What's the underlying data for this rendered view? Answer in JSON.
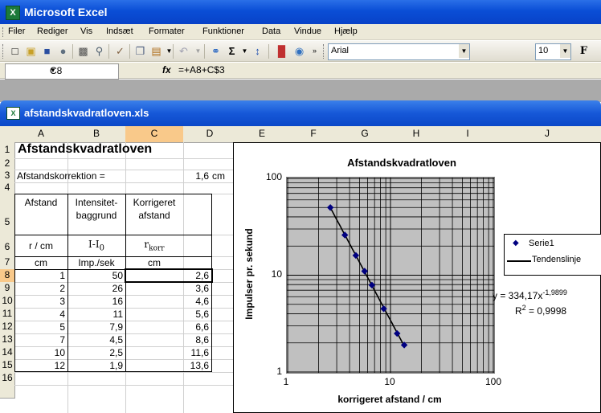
{
  "app": {
    "title": "Microsoft Excel"
  },
  "menu": [
    "Filer",
    "Rediger",
    "Vis",
    "Indsæt",
    "Formater",
    "Funktioner",
    "Data",
    "Vindue",
    "Hjælp"
  ],
  "toolbar": {
    "font": "Arial",
    "size": "10",
    "bold": "F"
  },
  "formula_bar": {
    "cell_ref": "C8",
    "fx": "fx",
    "formula": "=+A8+C$3"
  },
  "workbook": {
    "title": "afstandskvadratloven.xls"
  },
  "grid": {
    "columns": [
      "A",
      "B",
      "C",
      "D",
      "E",
      "F",
      "G",
      "H",
      "I",
      "J"
    ],
    "rows": [
      "1",
      "2",
      "3",
      "4",
      "5",
      "6",
      "7",
      "8",
      "9",
      "10",
      "11",
      "12",
      "13",
      "14",
      "15",
      "16"
    ]
  },
  "sheet": {
    "title": "Afstandskvadratloven",
    "correction_label": "Afstandskorrektion =",
    "correction_value": "1,6",
    "correction_unit": "cm",
    "headers": {
      "a": "Afstand",
      "b1": "Intensitet-",
      "b2": "baggrund",
      "c1": "Korrigeret",
      "c2": "afstand",
      "a_sym": "r / cm",
      "b_sym_main": "I-I",
      "b_sym_sub": "0",
      "c_sym_main": "r",
      "c_sym_sub": "korr",
      "a_unit": "cm",
      "b_unit": "Imp./sek",
      "c_unit": "cm"
    },
    "rows": [
      {
        "a": "1",
        "b": "50",
        "c": "2,6"
      },
      {
        "a": "2",
        "b": "26",
        "c": "3,6"
      },
      {
        "a": "3",
        "b": "16",
        "c": "4,6"
      },
      {
        "a": "4",
        "b": "11",
        "c": "5,6"
      },
      {
        "a": "5",
        "b": "7,9",
        "c": "6,6"
      },
      {
        "a": "7",
        "b": "4,5",
        "c": "8,6"
      },
      {
        "a": "10",
        "b": "2,5",
        "c": "11,6"
      },
      {
        "a": "12",
        "b": "1,9",
        "c": "13,6"
      }
    ]
  },
  "chart_data": {
    "type": "scatter",
    "title": "Afstandskvadratloven",
    "xlabel": "korrigeret afstand / cm",
    "ylabel": "Impulser pr. sekund",
    "x_scale": "log",
    "y_scale": "log",
    "xlim": [
      1,
      100
    ],
    "ylim": [
      1,
      100
    ],
    "x_ticks": [
      "1",
      "10",
      "100"
    ],
    "y_ticks": [
      "1",
      "10",
      "100"
    ],
    "grid": true,
    "legend_position": "right",
    "series": [
      {
        "name": "Serie1",
        "marker": "diamond",
        "color": "#000080",
        "x": [
          2.6,
          3.6,
          4.6,
          5.6,
          6.6,
          8.6,
          11.6,
          13.6
        ],
        "y": [
          50,
          26,
          16,
          11,
          7.9,
          4.5,
          2.5,
          1.9
        ]
      }
    ],
    "trendline": {
      "name": "Tendenslinje",
      "type": "power",
      "coefficient": 334.17,
      "exponent": -1.9899,
      "equation_main": "y = 334,17x",
      "equation_exp": "-1,9899",
      "r2_main": "R",
      "r2_sup": "2",
      "r2_value": " = 0,9998"
    }
  }
}
